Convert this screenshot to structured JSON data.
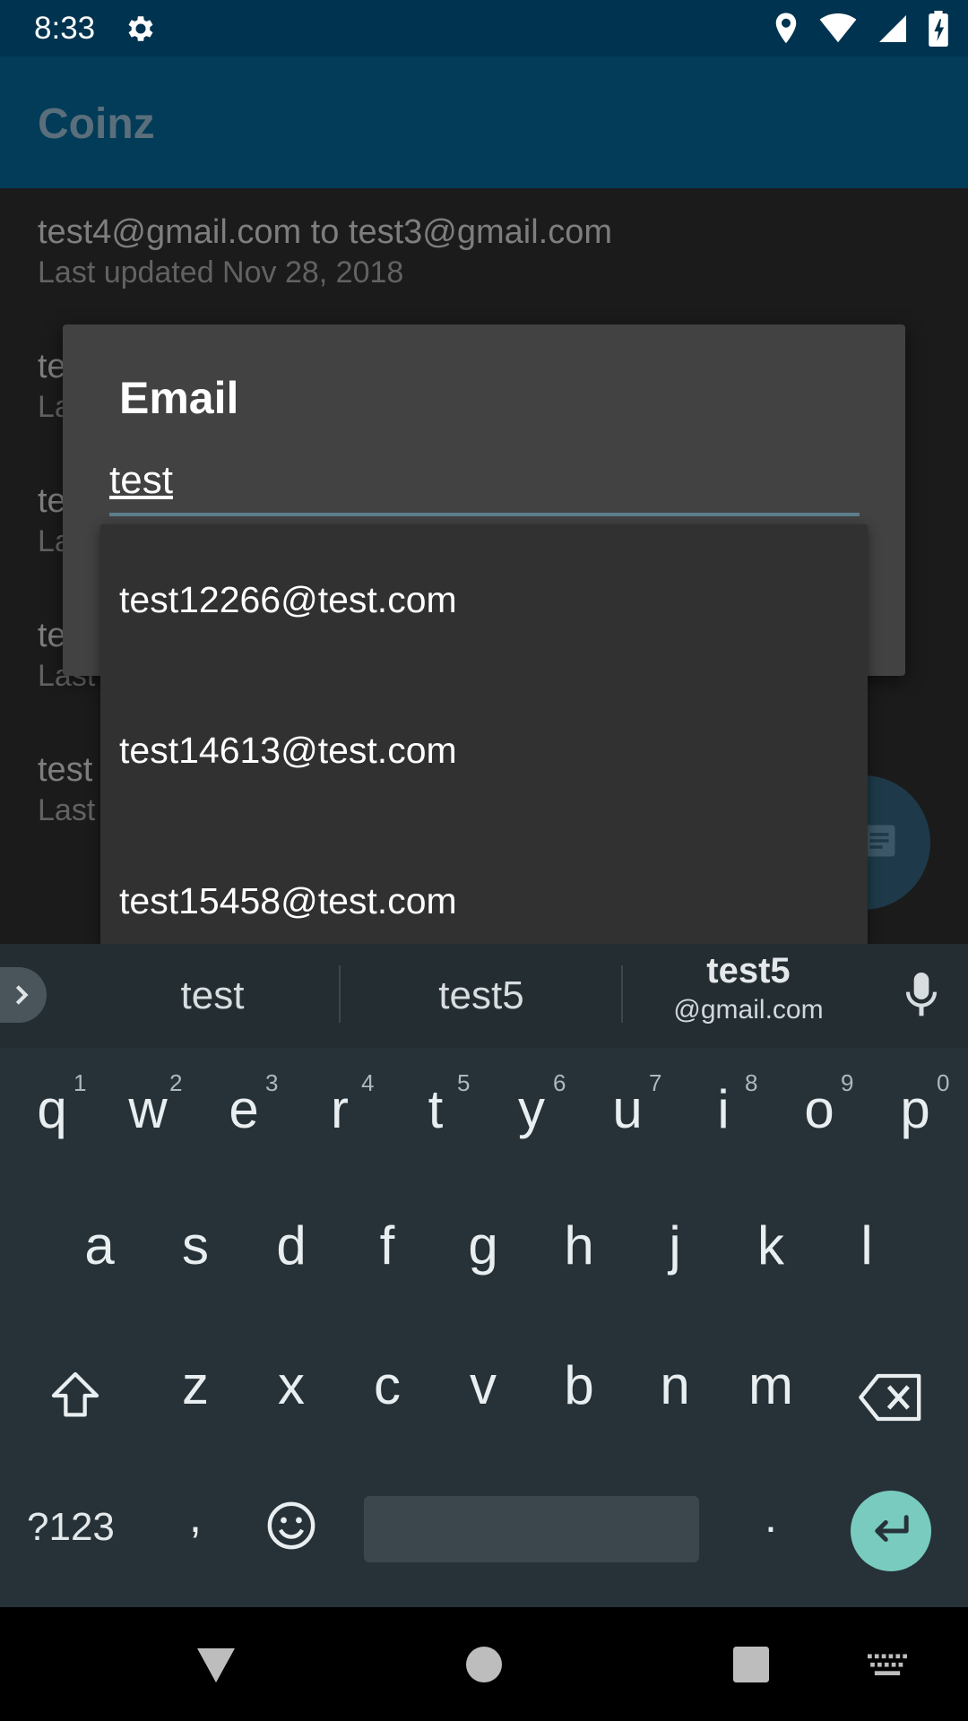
{
  "status_bar": {
    "time": "8:33"
  },
  "app_bar": {
    "title": "Coinz"
  },
  "list": {
    "items": [
      {
        "title": "test4@gmail.com to test3@gmail.com",
        "subtitle": "Last updated Nov 28, 2018"
      },
      {
        "title": "te",
        "subtitle": "La"
      },
      {
        "title": "te",
        "subtitle": "La"
      },
      {
        "title": "te",
        "subtitle": "Last"
      },
      {
        "title": "test",
        "subtitle": "Last"
      }
    ]
  },
  "dialog": {
    "title": "Email",
    "input_value": "test"
  },
  "dropdown": {
    "options": [
      "test12266@test.com",
      "test14613@test.com",
      "test15458@test.com"
    ]
  },
  "keyboard": {
    "suggestions": [
      "test",
      "test5",
      "test5",
      "@gmail.com"
    ],
    "row1": [
      "q",
      "w",
      "e",
      "r",
      "t",
      "y",
      "u",
      "i",
      "o",
      "p"
    ],
    "row1_nums": [
      "1",
      "2",
      "3",
      "4",
      "5",
      "6",
      "7",
      "8",
      "9",
      "0"
    ],
    "row2": [
      "a",
      "s",
      "d",
      "f",
      "g",
      "h",
      "j",
      "k",
      "l"
    ],
    "row3": [
      "z",
      "x",
      "c",
      "v",
      "b",
      "n",
      "m"
    ],
    "symbols_label": "?123",
    "comma": ",",
    "period": "."
  },
  "colors": {
    "accent": "#79cbc0",
    "status_bar": "#00334f",
    "app_bar": "#023c58"
  },
  "icons": [
    "settings-icon",
    "location-icon",
    "wifi-icon",
    "signal-icon",
    "battery-icon",
    "chevron-right-icon",
    "microphone-icon",
    "shift-icon",
    "backspace-icon",
    "emoji-icon",
    "enter-icon",
    "back-icon",
    "home-icon",
    "recents-icon",
    "keyboard-icon"
  ]
}
